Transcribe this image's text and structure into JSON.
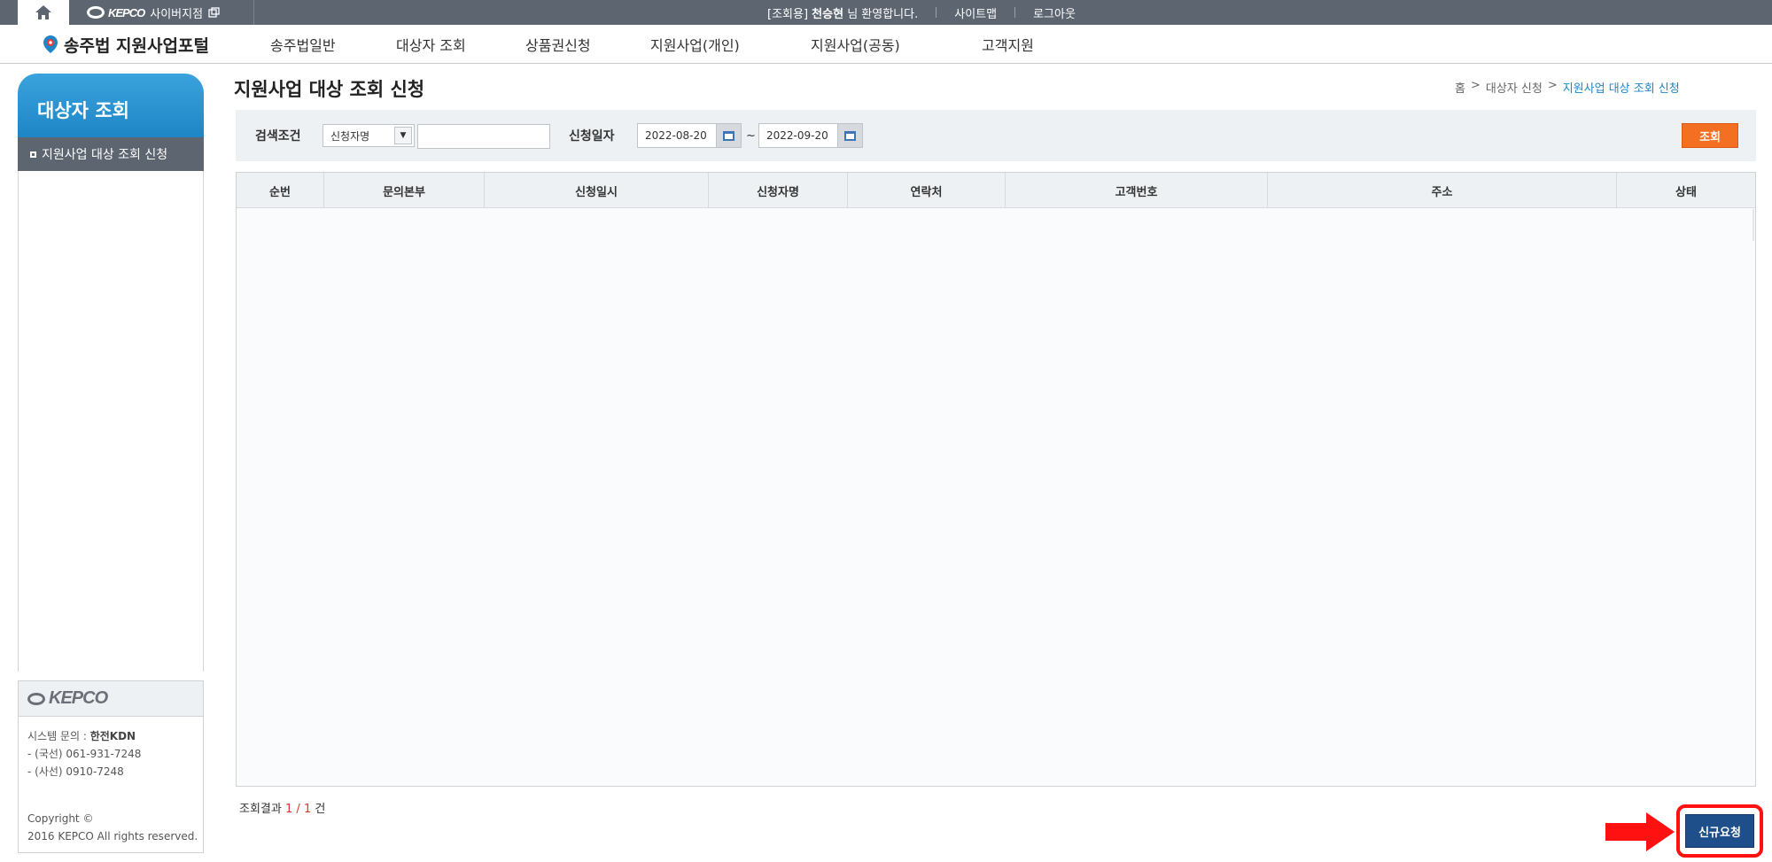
{
  "topbar": {
    "kepco_logo": "KEPCO",
    "cyber_branch": "사이버지점",
    "welcome_prefix": "[조회용]",
    "user_name": "천승현",
    "welcome_suffix": "님 환영합니다.",
    "sitemap": "사이트맵",
    "logout": "로그아웃"
  },
  "nav": {
    "brand": "송주법 지원사업포털",
    "items": [
      "송주법일반",
      "대상자 조회",
      "상품권신청",
      "지원사업(개인)",
      "지원사업(공동)",
      "고객지원"
    ]
  },
  "sidebar": {
    "title": "대상자 조회",
    "items": [
      "지원사업 대상 조회 신청"
    ]
  },
  "infobox": {
    "logo": "KEPCO",
    "inquiry_label": "시스템 문의 :",
    "inquiry_org": "한전KDN",
    "phone1": "- (국선) 061-931-7248",
    "phone2": "- (사선) 0910-7248",
    "copyright1": "Copyright ©",
    "copyright2": "2016 KEPCO All rights reserved."
  },
  "page": {
    "title": "지원사업 대상 조회 신청",
    "breadcrumb": [
      "홈",
      ">",
      "대상자 신청",
      ">",
      "지원사업 대상 조회 신청"
    ]
  },
  "search": {
    "condition_label": "검색조건",
    "condition_value": "신청자명",
    "keyword_value": "",
    "date_label": "신청일자",
    "date_from": "2022-08-20",
    "tilde": "~",
    "date_to": "2022-09-20",
    "query_button": "조회"
  },
  "grid": {
    "columns": [
      "순번",
      "문의본부",
      "신청일시",
      "신청자명",
      "연락처",
      "고객번호",
      "주소",
      "상태"
    ],
    "rows": []
  },
  "result": {
    "label": "조회결과",
    "current": "1",
    "slash": "/",
    "total": "1",
    "unit": "건"
  },
  "actions": {
    "new_request": "신규요청"
  },
  "colors": {
    "topbar": "#5d6571",
    "accent_blue": "#1f86c6",
    "query_orange": "#f36f21",
    "new_button_navy": "#1e4f8b",
    "highlight_red": "#ff1111"
  }
}
